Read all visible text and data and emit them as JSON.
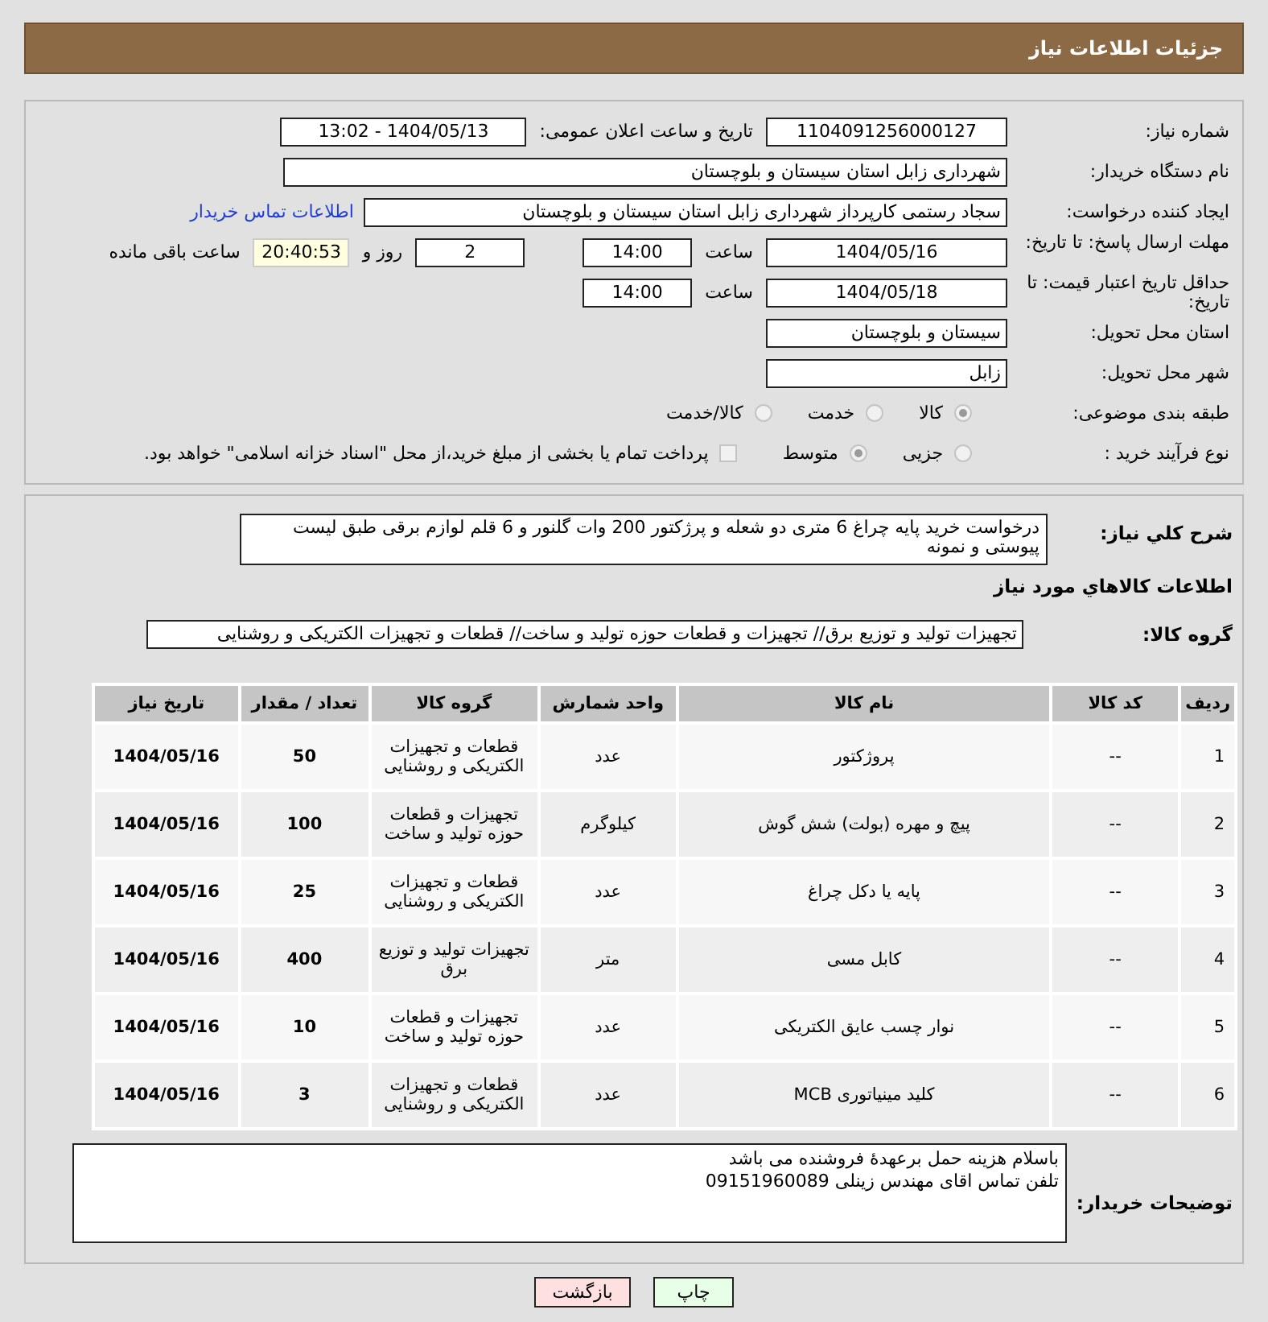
{
  "header": {
    "title": "جزئیات اطلاعات نیاز"
  },
  "fields": {
    "need_number": {
      "label": "شماره نیاز:",
      "value": "1104091256000127"
    },
    "announce": {
      "label": "تاریخ و ساعت اعلان عمومی:",
      "value": "1404/05/13 - 13:02"
    },
    "buyer_org": {
      "label": "نام دستگاه خریدار:",
      "value": "شهرداری زابل استان سیستان و بلوچستان"
    },
    "requester": {
      "label": "ایجاد کننده درخواست:",
      "value": "سجاد رستمی کارپرداز شهرداری زابل استان سیستان و بلوچستان",
      "link": "اطلاعات تماس خریدار"
    },
    "reply_deadline": {
      "label": "مهلت ارسال پاسخ: تا تاریخ:",
      "date": "1404/05/16",
      "time_label": "ساعت",
      "time": "14:00",
      "days": "2",
      "days_label": "روز و",
      "remaining": "20:40:53",
      "remaining_label": "ساعت باقی مانده"
    },
    "validity": {
      "label": "حداقل تاریخ اعتبار قیمت: تا تاریخ:",
      "date": "1404/05/18",
      "time_label": "ساعت",
      "time": "14:00"
    },
    "province": {
      "label": "استان محل تحویل:",
      "value": "سیستان و بلوچستان"
    },
    "city": {
      "label": "شهر محل تحویل:",
      "value": "زابل"
    },
    "category": {
      "label": "طبقه بندی موضوعی:",
      "options": [
        {
          "label": "کالا",
          "selected": true
        },
        {
          "label": "خدمت",
          "selected": false
        },
        {
          "label": "کالا/خدمت",
          "selected": false
        }
      ]
    },
    "process": {
      "label": "نوع فرآیند خرید :",
      "options": [
        {
          "label": "جزیی",
          "selected": false
        },
        {
          "label": "متوسط",
          "selected": true
        }
      ],
      "checkbox": {
        "label": "پرداخت تمام یا بخشی از مبلغ خرید،از محل \"اسناد خزانه اسلامی\" خواهد بود.",
        "checked": false
      }
    }
  },
  "description": {
    "label": "شرح کلي نياز:",
    "value": "درخواست خرید پایه چراغ 6 متری دو شعله و پرژکتور 200 وات گلنور و 6 قلم لوازم برقی طبق لیست پیوستی و نمونه"
  },
  "goods_title": "اطلاعات کالاهاي مورد نياز",
  "group": {
    "label": "گروه کالا:",
    "value": "تجهیزات تولید و توزیع برق// تجهیزات و قطعات حوزه تولید و ساخت// قطعات و تجهیزات الکتریکی و روشنایی"
  },
  "table": {
    "columns": [
      "ردیف",
      "کد کالا",
      "نام کالا",
      "واحد شمارش",
      "گروه کالا",
      "تعداد / مقدار",
      "تاریخ نیاز"
    ],
    "rows": [
      [
        "1",
        "--",
        "پروژکتور",
        "عدد",
        "قطعات و تجهیزات الکتریکی و روشنایی",
        "50",
        "1404/05/16"
      ],
      [
        "2",
        "--",
        "پیچ و مهره (بولت) شش گوش",
        "کیلوگرم",
        "تجهیزات و قطعات حوزه تولید و ساخت",
        "100",
        "1404/05/16"
      ],
      [
        "3",
        "--",
        "پایه یا دکل چراغ",
        "عدد",
        "قطعات و تجهیزات الکتریکی و روشنایی",
        "25",
        "1404/05/16"
      ],
      [
        "4",
        "--",
        "کابل مسی",
        "متر",
        "تجهیزات تولید و توزیع برق",
        "400",
        "1404/05/16"
      ],
      [
        "5",
        "--",
        "نوار چسب عایق الکتریکی",
        "عدد",
        "تجهیزات و قطعات حوزه تولید و ساخت",
        "10",
        "1404/05/16"
      ],
      [
        "6",
        "--",
        "کلید مینیاتوری MCB",
        "عدد",
        "قطعات و تجهیزات الکتریکی و روشنایی",
        "3",
        "1404/05/16"
      ]
    ]
  },
  "buyer_notes": {
    "label": "توضیحات خریدار:",
    "lines": [
      "باسلام هزینه حمل برعهدهٔ فروشنده می باشد",
      "تلفن تماس اقای مهندس زینلی 09151960089"
    ]
  },
  "buttons": [
    {
      "label": "چاپ",
      "kind": "print"
    },
    {
      "label": "بازگشت",
      "kind": "back"
    }
  ]
}
